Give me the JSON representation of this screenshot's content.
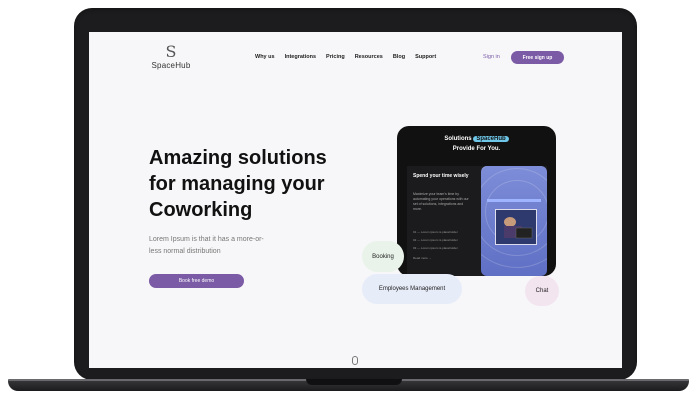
{
  "brand": {
    "name": "SpaceHub",
    "logo_mark": "S"
  },
  "nav": {
    "items": [
      "Why us",
      "Integrations",
      "Pricing",
      "Resources",
      "Blog",
      "Support"
    ],
    "signin_label": "Sign in",
    "signup_label": "Free sign up"
  },
  "hero": {
    "headline_lines": [
      "Amazing solutions",
      "for managing your",
      "Coworking"
    ],
    "subtext_lines": [
      "Lorem Ipsum is that it has a more-or-",
      "less normal distribution"
    ],
    "cta_label": "Book free demo"
  },
  "card": {
    "title_prefix": "Solutions",
    "title_badge": "SpaceHub",
    "title_suffix": "Provide For You.",
    "panel_heading": "Spend your time wisely",
    "panel_desc": "Maximize your team's time by automating your operations with our set of solutions, integrations and more.",
    "panel_lines": [
      "01 — Lorem ipsum is placeholder",
      "02 — Lorem ipsum is placeholder",
      "03 — Lorem ipsum is placeholder",
      "Read more  →"
    ]
  },
  "chips": {
    "booking": "Booking",
    "employees": "Employees Management",
    "chat": "Chat"
  }
}
